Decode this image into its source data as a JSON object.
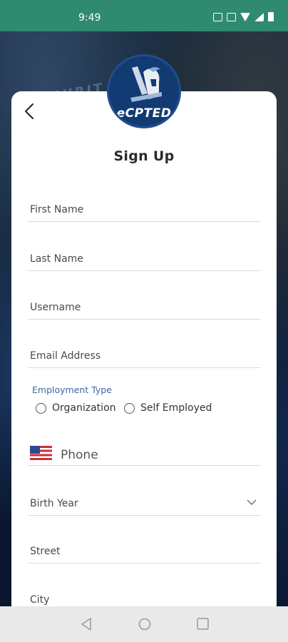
{
  "status": {
    "time": "9:49"
  },
  "brand": {
    "logo_text": "eCPTED",
    "background_text": "SECURIT"
  },
  "page": {
    "title": "Sign Up"
  },
  "form": {
    "first_name": {
      "placeholder": "First Name"
    },
    "last_name": {
      "placeholder": "Last Name"
    },
    "username": {
      "placeholder": "Username"
    },
    "email": {
      "placeholder": "Email Address"
    },
    "employment": {
      "label": "Employment Type",
      "options": [
        "Organization",
        "Self Employed"
      ]
    },
    "phone": {
      "placeholder": "Phone",
      "country_flag": "us-flag-icon"
    },
    "birth_year": {
      "placeholder": "Birth Year"
    },
    "street": {
      "placeholder": "Street"
    },
    "city": {
      "placeholder": "City"
    }
  },
  "colors": {
    "status_bar": "#2f8a70",
    "accent_label": "#3c68a6",
    "logo_bg": "#123a73"
  }
}
